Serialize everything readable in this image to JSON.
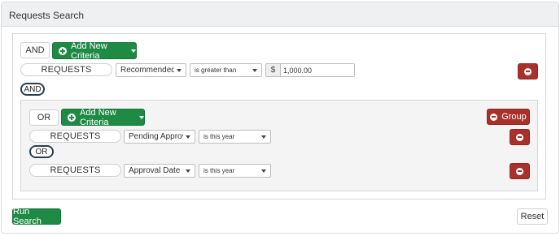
{
  "panel": {
    "title": "Requests Search"
  },
  "outer_group": {
    "logic_label": "AND",
    "add_criteria_label": "Add New Criteria",
    "criteria": [
      {
        "entity": "REQUESTS",
        "field": "Recommended A",
        "operator": "is greater than",
        "currency_symbol": "$",
        "value": "1,000.00"
      }
    ],
    "connector": "AND"
  },
  "inner_group": {
    "logic_label": "OR",
    "add_criteria_label": "Add New Criteria",
    "remove_group_label": "Group",
    "criteria": [
      {
        "entity": "REQUESTS",
        "field": "Pending Approva",
        "operator": "is this year"
      },
      {
        "entity": "REQUESTS",
        "field": "Approval Date",
        "operator": "is this year"
      }
    ],
    "connector": "OR"
  },
  "footer": {
    "run_label": "Run Search",
    "reset_label": "Reset"
  },
  "colors": {
    "green": "#1e8a43",
    "red": "#a8322b",
    "panel_header": "#eef0f2",
    "inner_background": "#f4f4f4"
  },
  "icons": {
    "add": "plus-circle-icon",
    "remove": "minus-circle-icon",
    "dropdown": "caret-down-icon"
  }
}
